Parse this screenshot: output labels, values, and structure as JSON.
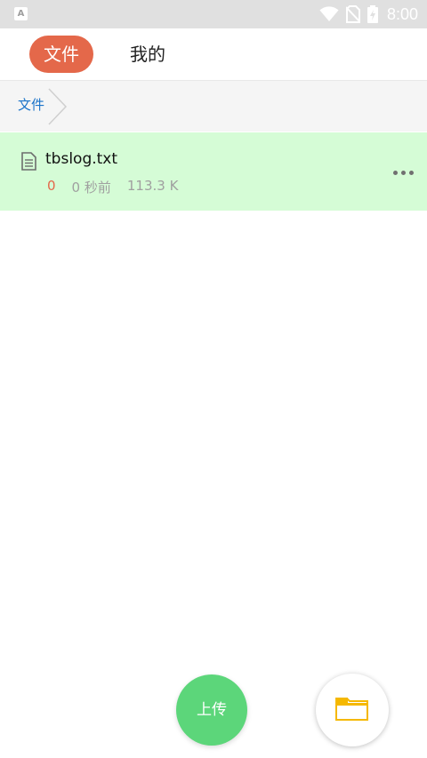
{
  "status_bar": {
    "app_icon_letter": "A",
    "time": "8:00"
  },
  "tabs": {
    "files_label": "文件",
    "mine_label": "我的"
  },
  "breadcrumb": {
    "root_label": "文件"
  },
  "files": [
    {
      "name": "tbslog.txt",
      "count": "0",
      "time": "0 秒前",
      "size": "113.3 K"
    }
  ],
  "actions": {
    "upload_label": "上传"
  },
  "colors": {
    "accent": "#e4684a",
    "row_highlight": "#d5fcd6",
    "upload": "#5cd67a",
    "folder": "#f5b800",
    "link": "#1a73c9"
  }
}
